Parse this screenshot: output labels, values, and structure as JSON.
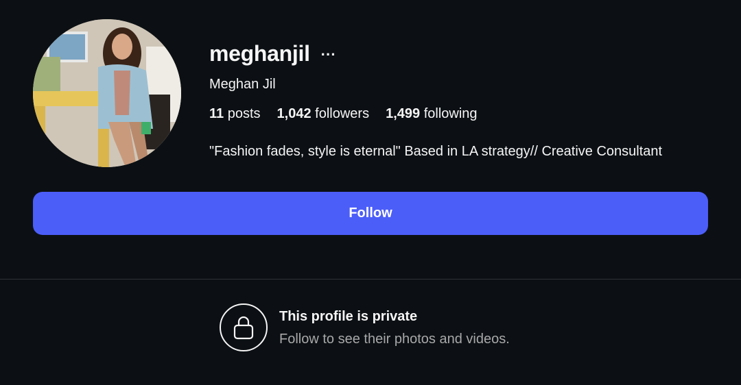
{
  "profile": {
    "username": "meghanjil",
    "full_name": "Meghan Jil",
    "bio": "\"Fashion fades, style is eternal\" Based in LA strategy// Creative Consultant",
    "avatar_icon": "profile-photo"
  },
  "stats": {
    "posts_count": "11",
    "posts_label": "posts",
    "followers_count": "1,042",
    "followers_label": "followers",
    "following_count": "1,499",
    "following_label": "following"
  },
  "actions": {
    "more_label": "···",
    "follow_label": "Follow"
  },
  "private_notice": {
    "icon": "lock-icon",
    "title": "This profile is private",
    "subtitle": "Follow to see their photos and videos."
  },
  "colors": {
    "background": "#0c1014",
    "accent": "#4c5ef8",
    "text": "#f5f5f5",
    "secondary_text": "#a8a8a8"
  }
}
